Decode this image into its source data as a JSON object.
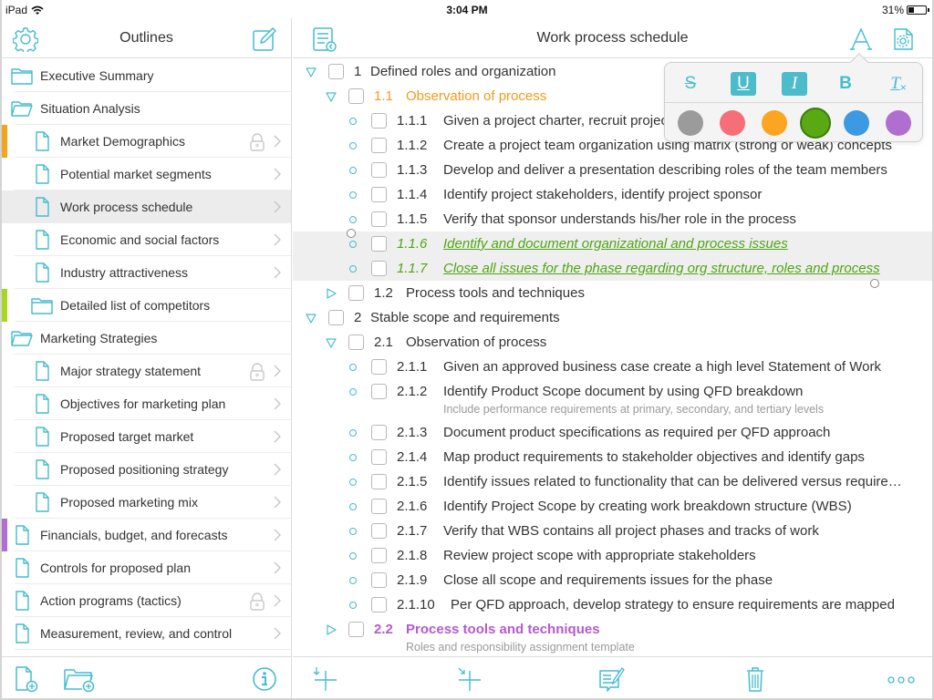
{
  "status_bar": {
    "device": "iPad",
    "time": "3:04 PM",
    "battery": "31%",
    "battery_level": 0.31
  },
  "sidebar": {
    "title": "Outlines",
    "header_icons": {
      "left": "settings-gear-icon",
      "right": "compose-edit-icon"
    },
    "items": [
      {
        "label": "Executive Summary",
        "type": "folder-closed",
        "level": 0
      },
      {
        "label": "Situation Analysis",
        "type": "folder-open",
        "level": 0
      },
      {
        "label": "Market Demographics",
        "type": "document",
        "level": 1,
        "locked": true,
        "color": "#f2a51d"
      },
      {
        "label": "Potential market segments",
        "type": "document",
        "level": 1
      },
      {
        "label": "Work process schedule",
        "type": "document",
        "level": 1,
        "selected": true
      },
      {
        "label": "Economic and social factors",
        "type": "document",
        "level": 1
      },
      {
        "label": "Industry attractiveness",
        "type": "document",
        "level": 1
      },
      {
        "label": "Detailed list of competitors",
        "type": "folder-closed",
        "level": 1,
        "color": "#a6d81f"
      },
      {
        "label": "Marketing Strategies",
        "type": "folder-open",
        "level": 0
      },
      {
        "label": "Major strategy statement",
        "type": "document",
        "level": 1,
        "locked": true
      },
      {
        "label": "Objectives for marketing plan",
        "type": "document",
        "level": 1
      },
      {
        "label": "Proposed target market",
        "type": "document",
        "level": 1
      },
      {
        "label": "Proposed positioning strategy",
        "type": "document",
        "level": 1
      },
      {
        "label": "Proposed marketing mix",
        "type": "document",
        "level": 1
      },
      {
        "label": "Financials, budget, and forecasts",
        "type": "document",
        "level": 0,
        "color": "#b06fd0"
      },
      {
        "label": "Controls for proposed plan",
        "type": "document",
        "level": 0
      },
      {
        "label": "Action programs (tactics)",
        "type": "document",
        "level": 0,
        "locked": true
      },
      {
        "label": "Measurement, review, and control",
        "type": "document",
        "level": 0
      }
    ],
    "footer_icons": [
      "new-document-icon",
      "new-folder-icon",
      "info-icon"
    ]
  },
  "main": {
    "title": "Work process schedule",
    "header_icons": {
      "left": "outline-list-back-icon",
      "font": "font-format-icon",
      "settings": "document-settings-icon"
    },
    "rows": [
      {
        "num": "1",
        "text": "Defined roles and organization",
        "level": 0,
        "marker": "expanded"
      },
      {
        "num": "1.1",
        "text": "Observation of process",
        "level": 1,
        "marker": "expanded",
        "style": "orange"
      },
      {
        "num": "1.1.1",
        "text": "Given a project charter, recruit project team members",
        "level": 2,
        "marker": "bullet"
      },
      {
        "num": "1.1.2",
        "text": "Create a project team organization using matrix (strong or weak) concepts",
        "level": 2,
        "marker": "bullet"
      },
      {
        "num": "1.1.3",
        "text": "Develop and deliver a presentation describing roles of the team members",
        "level": 2,
        "marker": "bullet"
      },
      {
        "num": "1.1.4",
        "text": "Identify project stakeholders, identify project sponsor",
        "level": 2,
        "marker": "bullet"
      },
      {
        "num": "1.1.5",
        "text": "Verify that sponsor understands his/her role in the process",
        "level": 2,
        "marker": "bullet"
      },
      {
        "num": "1.1.6",
        "text": "Identify and document organizational and process issues",
        "level": 2,
        "marker": "bullet",
        "style": "green",
        "highlighted": true
      },
      {
        "num": "1.1.7",
        "text": "Close all issues for the phase regarding org structure, roles and process",
        "level": 2,
        "marker": "bullet",
        "style": "green",
        "highlighted": true
      },
      {
        "num": "1.2",
        "text": "Process tools and techniques",
        "level": 1,
        "marker": "collapsed"
      },
      {
        "num": "2",
        "text": "Stable scope and requirements",
        "level": 0,
        "marker": "expanded"
      },
      {
        "num": "2.1",
        "text": "Observation of process",
        "level": 1,
        "marker": "expanded"
      },
      {
        "num": "2.1.1",
        "text": "Given an approved business case create a high level Statement of Work",
        "level": 2,
        "marker": "bullet"
      },
      {
        "num": "2.1.2",
        "text": "Identify Product Scope document by using QFD breakdown",
        "level": 2,
        "marker": "bullet",
        "note": "Include performance requirements at primary, secondary, and tertiary levels"
      },
      {
        "num": "2.1.3",
        "text": "Document product specifications as required per QFD approach",
        "level": 2,
        "marker": "bullet"
      },
      {
        "num": "2.1.4",
        "text": "Map product requirements to stakeholder objectives and identify gaps",
        "level": 2,
        "marker": "bullet"
      },
      {
        "num": "2.1.5",
        "text": "Identify issues related to functionality that can be delivered versus require…",
        "level": 2,
        "marker": "bullet"
      },
      {
        "num": "2.1.6",
        "text": "Identify Project Scope by creating work breakdown structure (WBS)",
        "level": 2,
        "marker": "bullet"
      },
      {
        "num": "2.1.7",
        "text": "Verify that WBS contains all project phases and tracks of work",
        "level": 2,
        "marker": "bullet"
      },
      {
        "num": "2.1.8",
        "text": "Review project scope with appropriate stakeholders",
        "level": 2,
        "marker": "bullet"
      },
      {
        "num": "2.1.9",
        "text": "Close all scope and requirements issues for the phase",
        "level": 2,
        "marker": "bullet"
      },
      {
        "num": "2.1.10",
        "text": "Per QFD approach, develop strategy to ensure requirements are mapped",
        "level": 2,
        "marker": "bullet"
      },
      {
        "num": "2.2",
        "text": "Process tools and techniques",
        "level": 1,
        "marker": "collapsed",
        "style": "purple",
        "note": "Roles and responsibility assignment template"
      }
    ],
    "footer_icons": [
      "add-item-below-icon",
      "add-child-item-icon",
      "add-note-icon",
      "trash-icon",
      "more-options-icon"
    ]
  },
  "format_popover": {
    "styles": [
      {
        "name": "strikethrough",
        "glyph": "S",
        "active": false
      },
      {
        "name": "underline",
        "glyph": "U",
        "active": true
      },
      {
        "name": "italic",
        "glyph": "I",
        "active": true
      },
      {
        "name": "bold",
        "glyph": "B",
        "active": false
      },
      {
        "name": "clear-format",
        "glyph": "T",
        "active": false
      }
    ],
    "colors": [
      {
        "name": "gray",
        "hex": "#9b9b9b",
        "selected": false
      },
      {
        "name": "red",
        "hex": "#f76d78",
        "selected": false
      },
      {
        "name": "orange",
        "hex": "#fba523",
        "selected": false
      },
      {
        "name": "green",
        "hex": "#58a912",
        "selected": true
      },
      {
        "name": "blue",
        "hex": "#3d99e2",
        "selected": false
      },
      {
        "name": "purple",
        "hex": "#b06fd0",
        "selected": false
      }
    ]
  },
  "theme": {
    "accent": "#45bcd0"
  }
}
